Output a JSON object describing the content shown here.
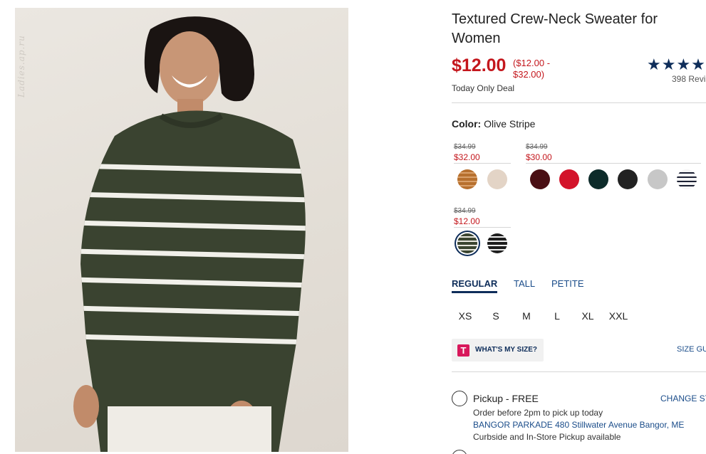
{
  "product": {
    "title": "Textured Crew-Neck Sweater for Women",
    "price": "$12.00",
    "price_range": "($12.00 - $32.00)",
    "deal_label": "Today Only Deal",
    "stars": "★★★★",
    "reviews": "398 Revi"
  },
  "watermark": "Ladies.ap.ru",
  "color": {
    "label": "Color:",
    "value": "Olive Stripe",
    "groups": [
      {
        "was": "$34.99",
        "now": "$32.00",
        "swatches": [
          "Camel stripe",
          "Oatmeal"
        ]
      },
      {
        "was": "$34.99",
        "now": "$30.00",
        "swatches": [
          "Burgundy",
          "Red",
          "Dark teal",
          "Black",
          "Heather grey",
          "White navy stripe"
        ]
      },
      {
        "was": "$34.99",
        "now": "$12.00",
        "swatches": [
          "Olive stripe",
          "Black white stripe"
        ]
      }
    ],
    "colors": {
      "camel": "#b7702e",
      "oatmeal": "#e3d4c6",
      "burgundy": "#4a0f14",
      "red": "#d3132a",
      "teal": "#0d2b2a",
      "black": "#222222",
      "grey": "#c7c7c7",
      "olive": "#3b4530",
      "stripe_white": "#f2f2f2"
    }
  },
  "fits": {
    "tabs": [
      "REGULAR",
      "TALL",
      "PETITE"
    ],
    "active": "REGULAR"
  },
  "sizes": [
    "XS",
    "S",
    "M",
    "L",
    "XL",
    "XXL"
  ],
  "size_help": {
    "label": "WHAT'S MY SIZE?",
    "icon_letter": "T",
    "guide": "SIZE GU"
  },
  "pickup": {
    "title": "Pickup - FREE",
    "change_store": "CHANGE STO",
    "line1": "Order before 2pm to pick up today",
    "store": "BANGOR PARKADE 480 Stillwater Avenue  Bangor, ME",
    "line3": "Curbside and In-Store Pickup available"
  },
  "brand_colors": {
    "sale_red": "#c4171d",
    "navy": "#0e2d5a",
    "link_blue": "#1b4d8a"
  }
}
